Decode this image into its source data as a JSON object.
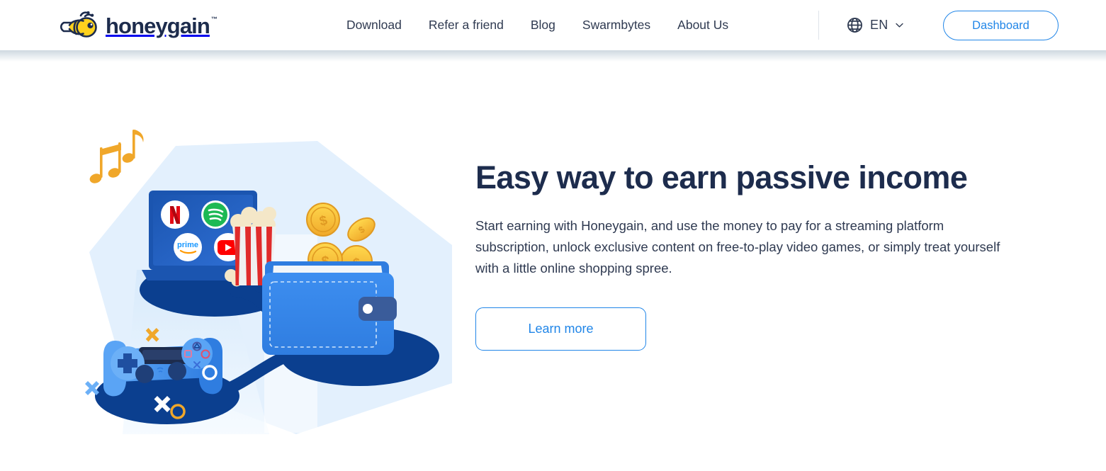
{
  "brand": {
    "name": "honeygain",
    "trademark": "™",
    "logo_icon": "bee-icon",
    "logo_body_color": "#ffd21e",
    "logo_outline_color": "#1d2c4d"
  },
  "nav": {
    "items": [
      {
        "label": "Download",
        "name": "nav-item-download"
      },
      {
        "label": "Refer a friend",
        "name": "nav-item-refer-a-friend"
      },
      {
        "label": "Blog",
        "name": "nav-item-blog"
      },
      {
        "label": "Swarmbytes",
        "name": "nav-item-swarmbytes"
      },
      {
        "label": "About Us",
        "name": "nav-item-about-us"
      }
    ],
    "language": {
      "code": "EN",
      "globe_icon": "globe-icon",
      "chevron_icon": "chevron-down-icon"
    },
    "dashboard_label": "Dashboard"
  },
  "hero": {
    "title": "Easy way to earn passive income",
    "description": "Start earning with Honeygain, and use the money to pay for a streaming platform subscription, unlock exclusive content on free-to-play video games, or simply treat yourself with a little online shopping spree.",
    "cta_label": "Learn more",
    "illustration": {
      "name": "passive-income-illustration",
      "backdrop_color": "#e3f0fd",
      "items": [
        "laptop-with-streaming-apps",
        "netflix-icon",
        "spotify-icon",
        "prime-video-icon",
        "youtube-icon",
        "popcorn-bucket",
        "music-notes",
        "game-controller",
        "wallet-with-coins",
        "dollar-coins"
      ],
      "streaming_logos": [
        "Netflix",
        "Spotify",
        "prime video",
        "YouTube"
      ]
    }
  },
  "colors": {
    "accent_blue": "#2186e8",
    "navy": "#1d2c4d",
    "text": "#2f3a51",
    "honey_yellow": "#ffd21e",
    "page_background": "#ffffff",
    "illustration_light_blue": "#e3f0fd",
    "illustration_deep_blue": "#0b3f8f",
    "illustration_mid_blue": "#3d8ef0"
  }
}
